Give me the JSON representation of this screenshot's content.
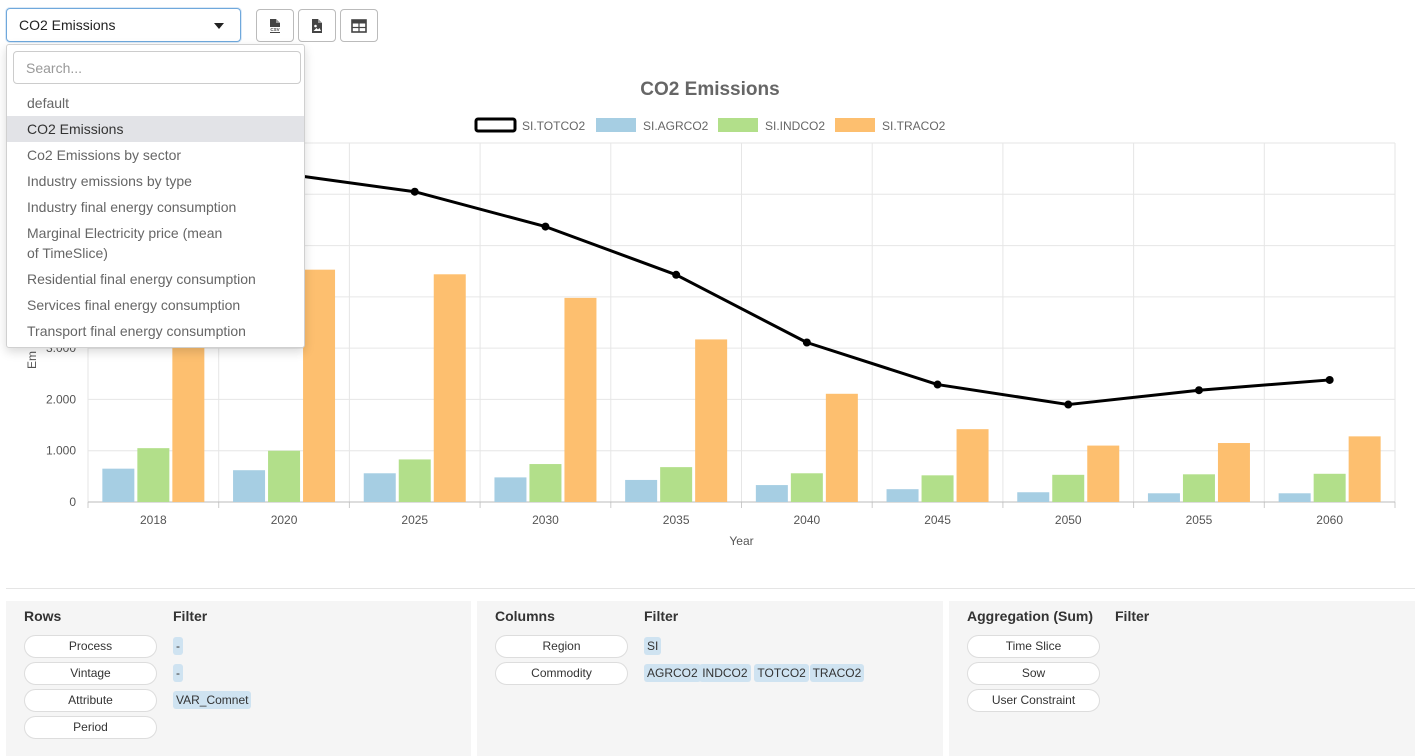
{
  "toolbar": {
    "selected_view": "CO2 Emissions",
    "buttons": [
      {
        "name": "export-csv-button",
        "icon": "csv-file-icon"
      },
      {
        "name": "export-image-button",
        "icon": "image-file-icon"
      },
      {
        "name": "table-view-button",
        "icon": "table-icon"
      }
    ]
  },
  "dropdown": {
    "search_placeholder": "Search...",
    "options": [
      {
        "label": "default"
      },
      {
        "label": "CO2 Emissions",
        "selected": true
      },
      {
        "label": "Co2 Emissions by sector"
      },
      {
        "label": "Industry emissions by type"
      },
      {
        "label": "Industry final energy consumption"
      },
      {
        "label": "Marginal Electricity price (mean of TimeSlice)"
      },
      {
        "label": "Residential final energy consumption"
      },
      {
        "label": "Services final energy consumption"
      },
      {
        "label": "Transport final energy consumption"
      }
    ]
  },
  "chart_data": {
    "type": "bar",
    "title": "CO2 Emissions",
    "xlabel": "Year",
    "ylabel": "Em",
    "categories": [
      "2018",
      "2020",
      "2025",
      "2030",
      "2035",
      "2040",
      "2045",
      "2050",
      "2055",
      "2060"
    ],
    "ylim": [
      0,
      7000
    ],
    "yticks": [
      0,
      1000,
      2000,
      3000
    ],
    "ytick_labels": [
      "0",
      "1.000",
      "2.000",
      "3.000"
    ],
    "grid": true,
    "legend_position": "top",
    "series": [
      {
        "name": "SI.TOTCO2",
        "type": "line",
        "color": "#000000",
        "values": [
          6700,
          6400,
          6050,
          5370,
          4430,
          3110,
          2290,
          1900,
          2180,
          2380
        ]
      },
      {
        "name": "SI.AGRCO2",
        "type": "bar",
        "color": "#a6cee3",
        "values": [
          650,
          620,
          560,
          480,
          430,
          330,
          250,
          190,
          170,
          170
        ]
      },
      {
        "name": "SI.INDCO2",
        "type": "bar",
        "color": "#b2df8a",
        "values": [
          1050,
          1000,
          830,
          740,
          680,
          560,
          520,
          530,
          540,
          550
        ]
      },
      {
        "name": "SI.TRACO2",
        "type": "bar",
        "color": "#fdbf6f",
        "values": [
          4900,
          4530,
          4440,
          3980,
          3170,
          2110,
          1420,
          1100,
          1150,
          1280
        ]
      }
    ]
  },
  "panels": {
    "rows": {
      "title": "Rows",
      "filter_title": "Filter",
      "items": [
        {
          "label": "Process",
          "filters": [
            "-"
          ]
        },
        {
          "label": "Vintage",
          "filters": [
            "-"
          ]
        },
        {
          "label": "Attribute",
          "filters": [
            "VAR_Comnet"
          ]
        },
        {
          "label": "Period",
          "filters": []
        }
      ]
    },
    "columns": {
      "title": "Columns",
      "filter_title": "Filter",
      "items": [
        {
          "label": "Region",
          "filters": [
            "SI"
          ]
        },
        {
          "label": "Commodity",
          "filters": [
            "AGRCO2",
            "INDCO2",
            "TOTCO2",
            "TRACO2"
          ]
        }
      ]
    },
    "aggregation": {
      "title": "Aggregation (Sum)",
      "filter_title": "Filter",
      "items": [
        {
          "label": "Time Slice"
        },
        {
          "label": "Sow"
        },
        {
          "label": "User Constraint"
        }
      ]
    }
  }
}
